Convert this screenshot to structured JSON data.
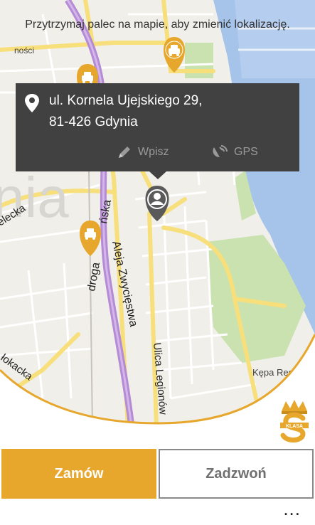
{
  "hint": "Przytrzymaj palec na mapie, aby zmienić lokalizację.",
  "address": {
    "line1": "ul. Kornela Ujejskiego 29,",
    "line2": "81-426 Gdynia"
  },
  "actions": {
    "type_label": "Wpisz",
    "gps_label": "GPS"
  },
  "map": {
    "labels": {
      "alleja": "Aleja Zwycięstwa",
      "droga": "droga",
      "droga_suffix": "ńska",
      "legionow": "Ulica Legionów",
      "kepa": "Kępa Redłowska",
      "elecka": "elecka",
      "lokacka": "łokacka",
      "nosci": "ności",
      "gdynia_faded": "nia"
    },
    "icons": [
      "taxi-marker-icon",
      "taxi-marker-icon",
      "taxi-marker-icon",
      "user-location-icon"
    ]
  },
  "buttons": {
    "order": "Zamów",
    "call": "Zadzwoń"
  },
  "more": "...",
  "logo_text": "KLASA",
  "colors": {
    "accent": "#e6a72c",
    "panel": "#414141",
    "sea": "#a6c3ea",
    "park": "#c9e2b0",
    "road": "#f7df7c",
    "route": "#b68bd6"
  }
}
